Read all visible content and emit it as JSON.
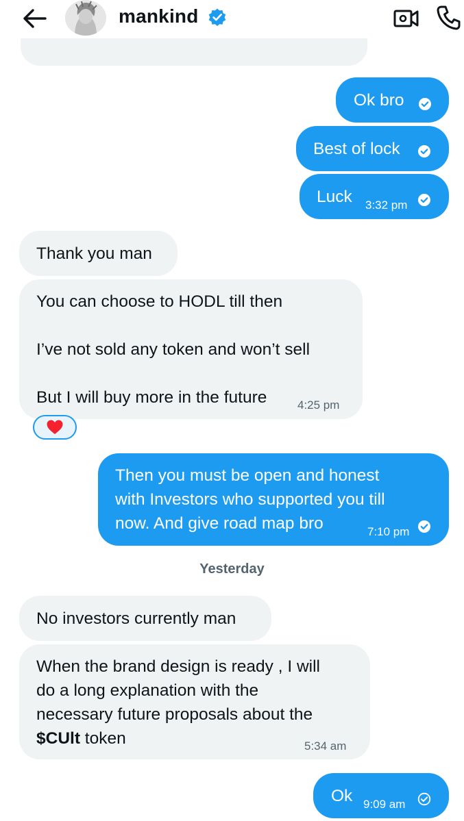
{
  "header": {
    "back_icon": "arrow-left-icon",
    "title": "mankind",
    "verified_icon": "verified-badge-icon",
    "video_icon": "video-call-icon",
    "phone_icon": "phone-call-icon"
  },
  "colors": {
    "accent": "#1d9bf0",
    "incoming_bg": "#eff3f4",
    "muted": "#536471"
  },
  "messages": [
    {
      "text": "Ok bro",
      "time": "",
      "status": "read-check-icon"
    },
    {
      "text": "Best of lock",
      "time": "",
      "status": "read-check-icon"
    },
    {
      "text": "Luck",
      "time": "3:32 pm",
      "status": "read-check-icon"
    },
    {
      "text": "Thank you man",
      "time": ""
    },
    {
      "lines": [
        "You can choose to HODL till then",
        "I’ve not sold any token and won’t sell",
        "But I will buy more in the future"
      ],
      "time": "4:25 pm",
      "reaction": "heart-icon"
    },
    {
      "lines": [
        "Then you must be open and honest",
        "with Investors who supported you till",
        "now. And give road map bro"
      ],
      "time": "7:10 pm",
      "status": "read-check-icon"
    },
    {
      "text": "No investors currently man",
      "time": ""
    },
    {
      "lines": [
        "When the brand design is ready , I will",
        "do a long explanation with the",
        "necessary future proposals about the"
      ],
      "bold": "$CUlt",
      "rest": " token",
      "time": "5:34 am"
    },
    {
      "text": "Ok",
      "time": "9:09 am",
      "status": "sent-check-icon"
    }
  ],
  "day_separator": "Yesterday"
}
